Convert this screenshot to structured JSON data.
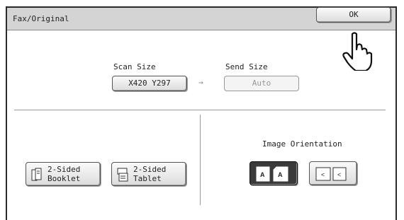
{
  "header": {
    "title": "Fax/Original",
    "ok_label": "OK"
  },
  "scan_size": {
    "label": "Scan Size",
    "value": "X420 Y297"
  },
  "send_size": {
    "label": "Send Size",
    "value": "Auto"
  },
  "arrow_glyph": "→",
  "duplex": {
    "booklet_label": "2-Sided\nBooklet",
    "tablet_label": "2-Sided\nTablet"
  },
  "orientation": {
    "label": "Image Orientation",
    "selected": "upright"
  },
  "colors": {
    "titlebar": "#d4d4d4",
    "selected": "#3a3a3a"
  }
}
